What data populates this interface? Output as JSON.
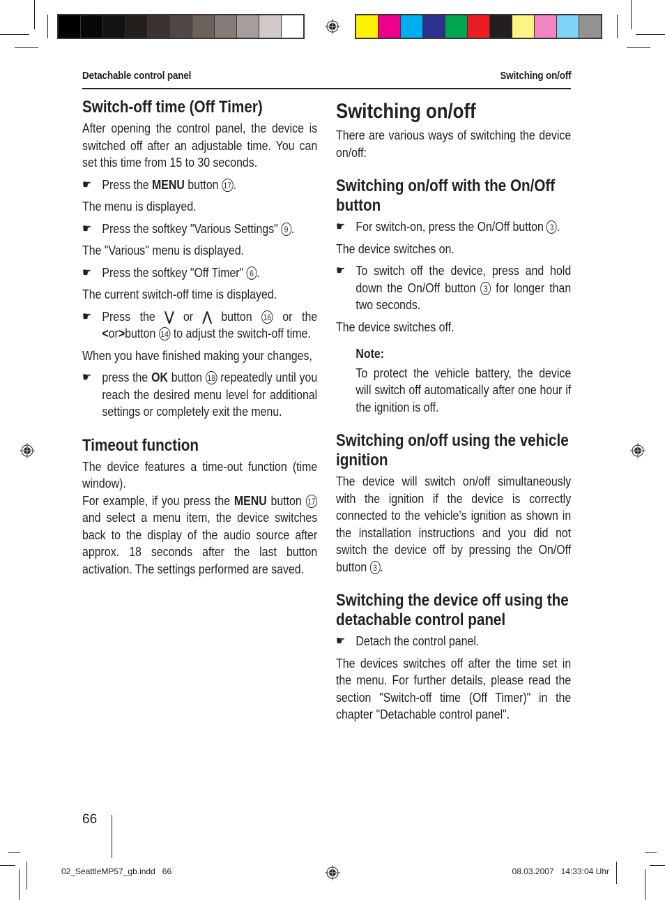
{
  "print_marks": {
    "gray_swatches": [
      "#000000",
      "#0a0807",
      "#141111",
      "#231f1d",
      "#3a3331",
      "#514846",
      "#6b605c",
      "#867b77",
      "#a69e9b",
      "#d2cac8",
      "#ffffff"
    ],
    "color_swatches": [
      "#fff200",
      "#ec008c",
      "#00aeef",
      "#2e3192",
      "#00a651",
      "#ed1c24",
      "#231f20",
      "#fff581",
      "#f484c4",
      "#7ed3f7",
      "#939191"
    ]
  },
  "header": {
    "left": "Detachable control panel",
    "right": "Switching on/off"
  },
  "left_column": {
    "section1": {
      "title": "Switch-off time (Off Timer)",
      "intro": "After opening the control panel, the device is switched off after an adjustable time. You can set this time from 15 to 30 seconds.",
      "step1_pre": "Press the ",
      "step1_bold": "MENU",
      "step1_post": " button ",
      "step1_num": "17",
      "step1_end": ".",
      "result1": "The menu is displayed.",
      "step2_pre": "Press the softkey \"Various Settings\" ",
      "step2_num": "9",
      "step2_end": ".",
      "result2": "The \"Various\" menu is displayed.",
      "step3_pre": "Press the softkey \"Off Timer\" ",
      "step3_num": "6",
      "step3_end": ".",
      "result3": "The current switch-off time is displayed.",
      "step4_a": "Press the ",
      "step4_down_icon": "⋁",
      "step4_b": " or ",
      "step4_up_icon": "⋀",
      "step4_c": " button ",
      "step4_num1": "16",
      "step4_d": " or the ",
      "step4_left_icon": "<",
      "step4_e": "or",
      "step4_right_icon": ">",
      "step4_f": "button ",
      "step4_num2": "14",
      "step4_g": " to adjust the switch-off time.",
      "result4": "When you have finished making your changes,",
      "step5_pre": "press the ",
      "step5_bold": "OK",
      "step5_post": " button ",
      "step5_num": "18",
      "step5_end": " repeatedly until you reach the desired menu level for additional settings or completely exit the menu."
    },
    "section2": {
      "title": "Timeout function",
      "para1": "The device features a time-out function (time window).",
      "para2_pre": "For example, if you press the ",
      "para2_bold": "MENU",
      "para2_mid": " button ",
      "para2_num": "17",
      "para2_end": " and select a menu item, the device switches back to the display of the audio source after approx. 18 seconds after the last button activation. The settings performed are saved."
    }
  },
  "right_column": {
    "title": "Switching on/off",
    "intro": "There are various ways of switching the device on/off:",
    "sub1": {
      "title": "Switching on/off with the On/Off button",
      "step1_pre": "For switch-on, press the On/Off button ",
      "step1_num": "3",
      "step1_end": ".",
      "result1": "The device switches on.",
      "step2_pre": "To switch off the device, press and hold down the On/Off button ",
      "step2_num": "3",
      "step2_end": " for longer than two seconds.",
      "result2": "The device switches off.",
      "note_label": "Note:",
      "note_text": "To protect the vehicle battery, the device will switch off automatically after one hour if the ignition is off."
    },
    "sub2": {
      "title": "Switching on/off using the vehicle ignition",
      "text_pre": "The device will switch on/off simultaneously with the ignition if the device is correctly connected to the vehicle’s ignition as shown in the installation instructions and you did not switch the device off by pressing the On/Off button ",
      "text_num": "3",
      "text_end": "."
    },
    "sub3": {
      "title": "Switching the device off using the detachable control panel",
      "step1": "Detach the control panel.",
      "result1": "The devices switches off after the time set in the menu. For further details, please read the section \"Switch-off time (Off Timer)\" in the chapter \"Detachable control panel\"."
    }
  },
  "footer": {
    "page_number": "66",
    "slug_left": "02_SeattleMP57_gb.indd   66",
    "slug_right": "08.03.2007   14:33:04 Uhr"
  },
  "icons": {
    "bullet": "☛"
  }
}
